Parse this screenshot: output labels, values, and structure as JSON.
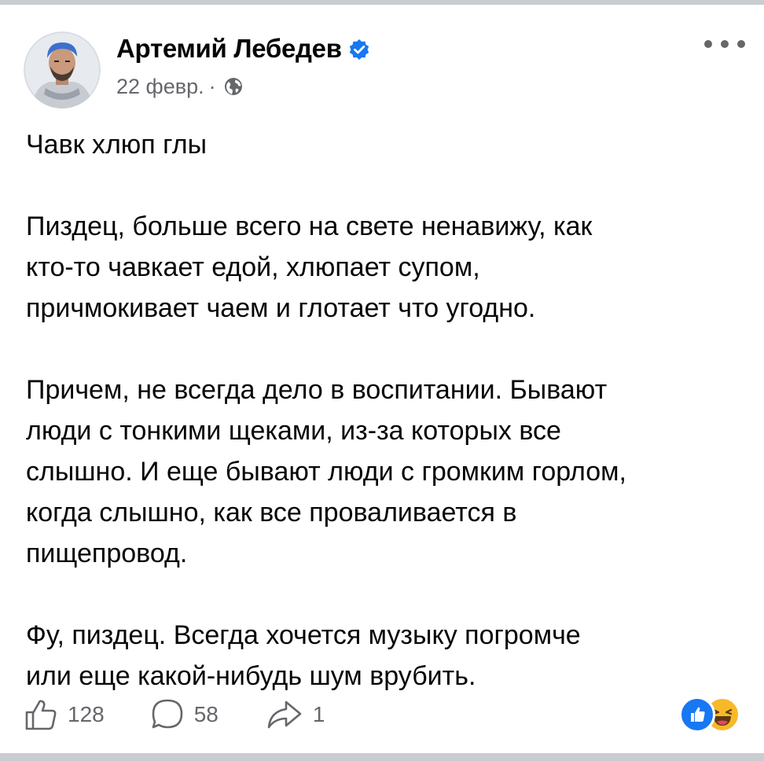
{
  "post": {
    "author": "Артемий Лебедев",
    "date": "22 февр.",
    "meta_separator": "·",
    "visibility_icon": "globe-icon",
    "verified_icon": "verified-badge-icon",
    "paragraphs": [
      [
        "Чавк хлюп глы"
      ],
      [
        "Пиздец, больше всего на свете ненавижу, как",
        "кто-то чавкает едой, хлюпает супом,",
        "причмокивает чаем и глотает что угодно."
      ],
      [
        "Причем, не всегда дело в воспитании. Бывают",
        "люди с тонкими щеками, из-за которых все",
        "слышно. И еще бывают люди с громким горлом,",
        "когда слышно, как все проваливается в",
        "пищепровод."
      ],
      [
        "Фу, пиздец. Всегда хочется музыку погромче",
        "или еще какой-нибудь шум врубить."
      ]
    ]
  },
  "actions": {
    "likes": "128",
    "comments": "58",
    "shares": "1"
  },
  "reactions": [
    "like-reaction-icon",
    "haha-reaction-icon"
  ],
  "colors": {
    "accent": "#1877f2",
    "secondary_text": "#65676b",
    "border": "#c9ccd1",
    "haha": "#f7b928"
  }
}
